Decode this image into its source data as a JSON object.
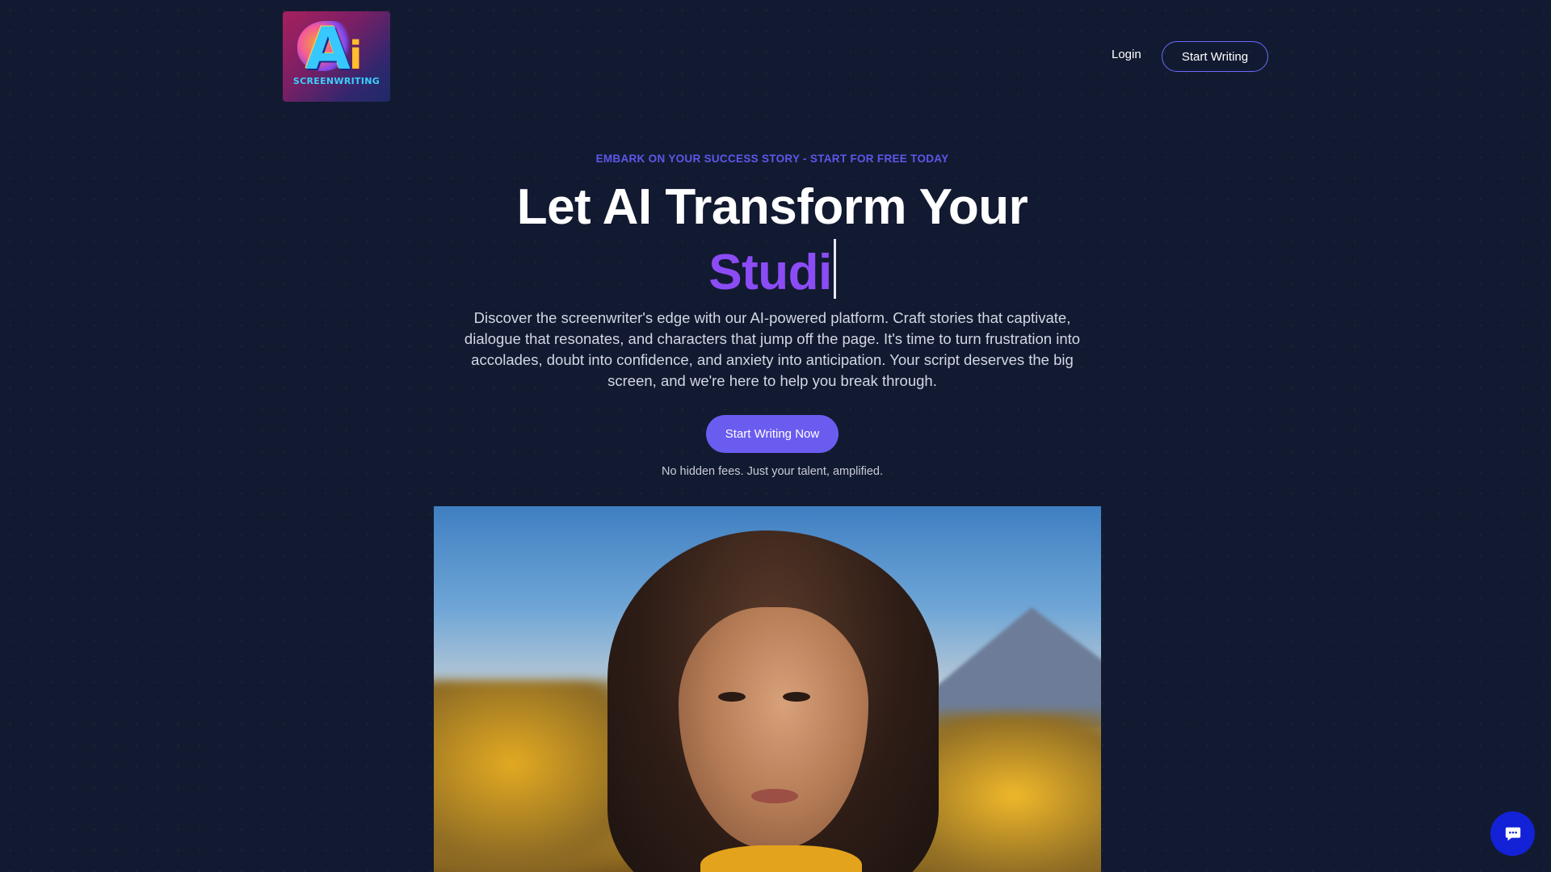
{
  "header": {
    "logo": {
      "letter_a": "A",
      "letter_i": "i",
      "wordmark": "SCREENWRITING"
    },
    "login_label": "Login",
    "start_writing_label": "Start Writing"
  },
  "hero": {
    "eyebrow": "EMBARK ON YOUR SUCCESS STORY - START FOR FREE TODAY",
    "headline": "Let AI Transform Your",
    "rotating_word": "Studi",
    "description": "Discover the screenwriter's edge with our AI-powered platform. Craft stories that captivate, dialogue that resonates, and characters that jump off the page. It's time to turn frustration into accolades, doubt into confidence, and anxiety into anticipation. Your script deserves the big screen, and we're here to help you break through.",
    "cta_label": "Start Writing Now",
    "fine_print": "No hidden fees. Just your talent, amplified."
  },
  "icons": {
    "chat": "chat-bubble-icon"
  },
  "colors": {
    "background": "#121a31",
    "accent": "#6b5cf0",
    "eyebrow": "#5f56ea",
    "rotating_word": "#8b4cf6",
    "chat_button": "#1322d6"
  }
}
